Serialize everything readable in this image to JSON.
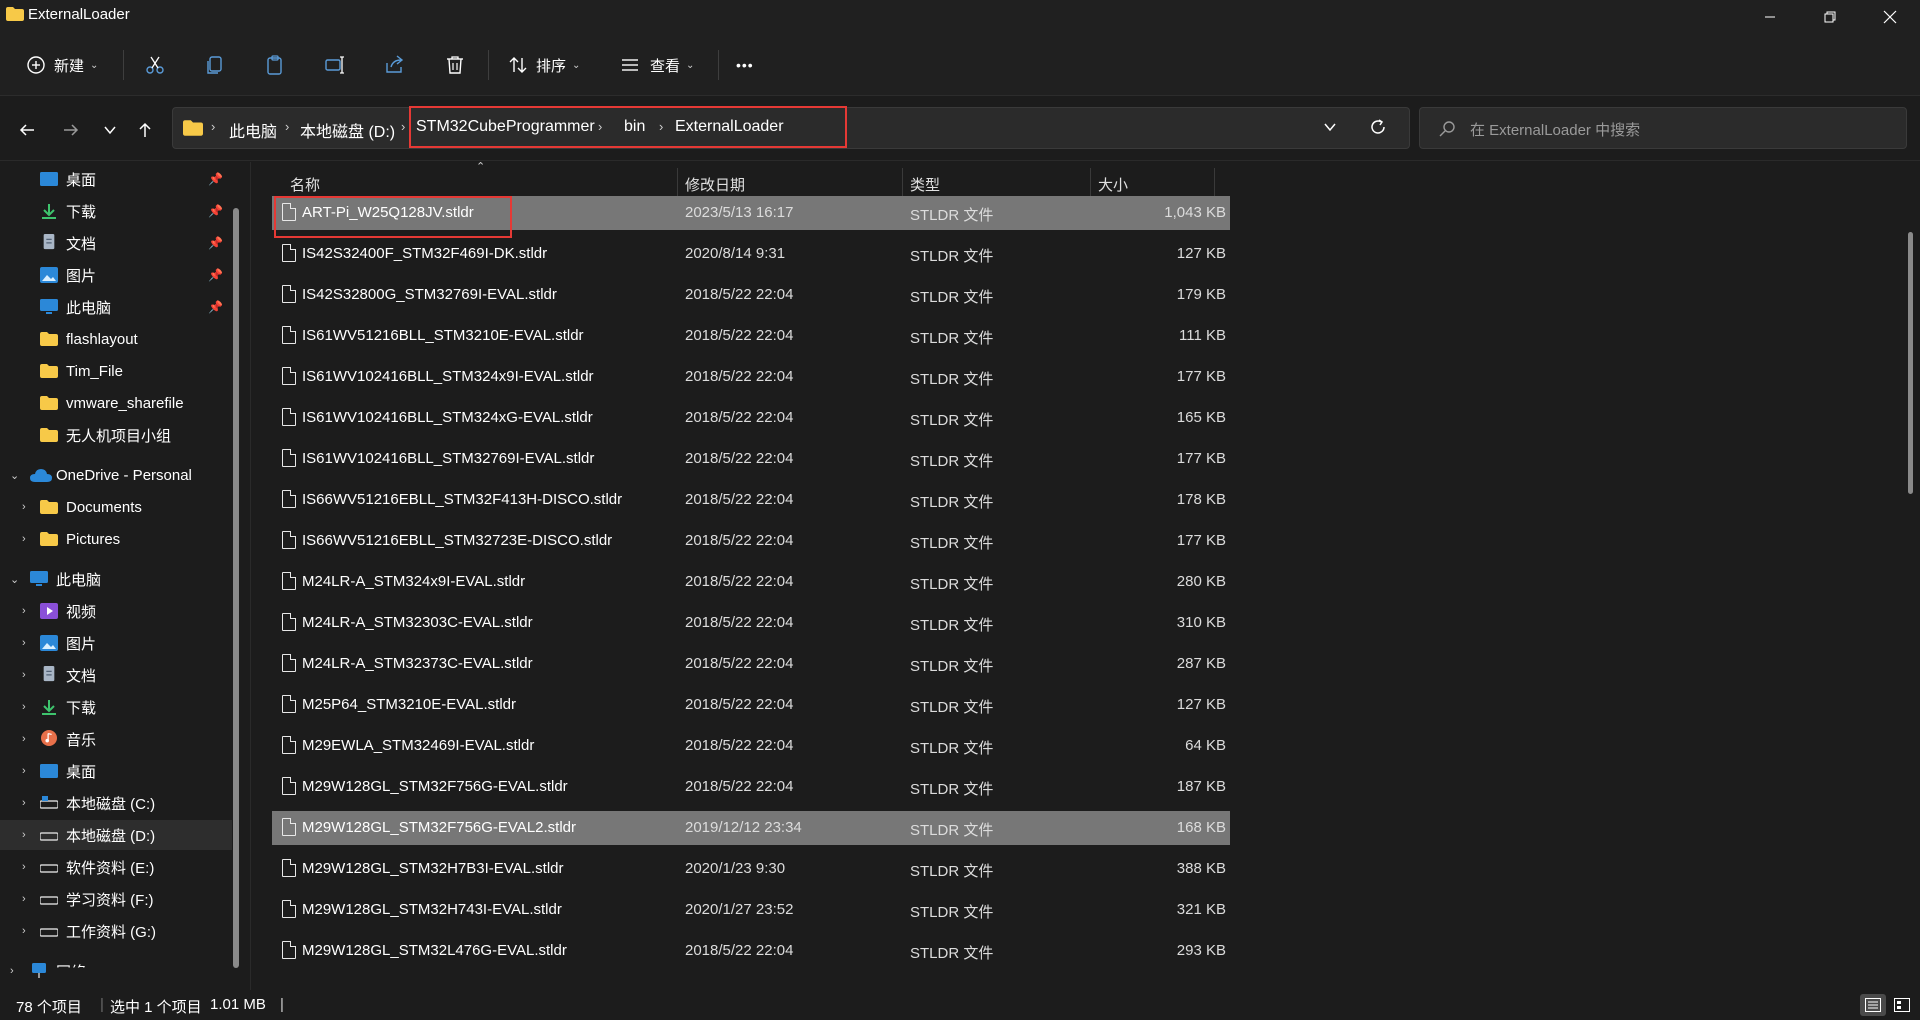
{
  "window": {
    "title": "ExternalLoader"
  },
  "toolbar": {
    "new_label": "新建",
    "sort_label": "排序",
    "view_label": "查看",
    "more_label": "•••"
  },
  "address": {
    "crumbs": [
      "此电脑",
      "本地磁盘 (D:)",
      "STM32CubeProgrammer",
      "bin",
      "ExternalLoader"
    ],
    "search_placeholder": "在 ExternalLoader 中搜索"
  },
  "sidebar": {
    "quick": [
      {
        "label": "桌面",
        "icon": "desktop-icon",
        "pinned": true
      },
      {
        "label": "下载",
        "icon": "download-icon",
        "pinned": true
      },
      {
        "label": "文档",
        "icon": "document-icon",
        "pinned": true
      },
      {
        "label": "图片",
        "icon": "pictures-icon",
        "pinned": true
      },
      {
        "label": "此电脑",
        "icon": "computer-icon",
        "pinned": true
      },
      {
        "label": "flashlayout",
        "icon": "folder-icon",
        "pinned": false
      },
      {
        "label": "Tim_File",
        "icon": "folder-icon",
        "pinned": false
      },
      {
        "label": "vmware_sharefile",
        "icon": "folder-icon",
        "pinned": false
      },
      {
        "label": "无人机项目小组",
        "icon": "folder-icon",
        "pinned": false
      }
    ],
    "onedrive": {
      "label": "OneDrive - Personal"
    },
    "onedrive_children": [
      {
        "label": "Documents"
      },
      {
        "label": "Pictures"
      }
    ],
    "thispc": {
      "label": "此电脑"
    },
    "thispc_children": [
      {
        "label": "视频",
        "icon": "video-icon"
      },
      {
        "label": "图片",
        "icon": "pictures-icon"
      },
      {
        "label": "文档",
        "icon": "document-icon"
      },
      {
        "label": "下载",
        "icon": "download-icon"
      },
      {
        "label": "音乐",
        "icon": "music-icon"
      },
      {
        "label": "桌面",
        "icon": "desktop-icon"
      },
      {
        "label": "本地磁盘 (C:)",
        "icon": "drive-icon"
      },
      {
        "label": "本地磁盘 (D:)",
        "icon": "drive-icon"
      },
      {
        "label": "软件资料 (E:)",
        "icon": "drive-icon"
      },
      {
        "label": "学习资料 (F:)",
        "icon": "drive-icon"
      },
      {
        "label": "工作资料 (G:)",
        "icon": "drive-icon"
      }
    ],
    "network": {
      "label": "网络"
    }
  },
  "columns": {
    "name": "名称",
    "date": "修改日期",
    "type": "类型",
    "size": "大小"
  },
  "files": [
    {
      "name": "ART-Pi_W25Q128JV.stldr",
      "date": "2023/5/13 16:17",
      "type": "STLDR 文件",
      "size": "1,043 KB"
    },
    {
      "name": "IS42S32400F_STM32F469I-DK.stldr",
      "date": "2020/8/14 9:31",
      "type": "STLDR 文件",
      "size": "127 KB"
    },
    {
      "name": "IS42S32800G_STM32769I-EVAL.stldr",
      "date": "2018/5/22 22:04",
      "type": "STLDR 文件",
      "size": "179 KB"
    },
    {
      "name": "IS61WV51216BLL_STM3210E-EVAL.stldr",
      "date": "2018/5/22 22:04",
      "type": "STLDR 文件",
      "size": "111 KB"
    },
    {
      "name": "IS61WV102416BLL_STM324x9I-EVAL.stldr",
      "date": "2018/5/22 22:04",
      "type": "STLDR 文件",
      "size": "177 KB"
    },
    {
      "name": "IS61WV102416BLL_STM324xG-EVAL.stldr",
      "date": "2018/5/22 22:04",
      "type": "STLDR 文件",
      "size": "165 KB"
    },
    {
      "name": "IS61WV102416BLL_STM32769I-EVAL.stldr",
      "date": "2018/5/22 22:04",
      "type": "STLDR 文件",
      "size": "177 KB"
    },
    {
      "name": "IS66WV51216EBLL_STM32F413H-DISCO.stldr",
      "date": "2018/5/22 22:04",
      "type": "STLDR 文件",
      "size": "178 KB"
    },
    {
      "name": "IS66WV51216EBLL_STM32723E-DISCO.stldr",
      "date": "2018/5/22 22:04",
      "type": "STLDR 文件",
      "size": "177 KB"
    },
    {
      "name": "M24LR-A_STM324x9I-EVAL.stldr",
      "date": "2018/5/22 22:04",
      "type": "STLDR 文件",
      "size": "280 KB"
    },
    {
      "name": "M24LR-A_STM32303C-EVAL.stldr",
      "date": "2018/5/22 22:04",
      "type": "STLDR 文件",
      "size": "310 KB"
    },
    {
      "name": "M24LR-A_STM32373C-EVAL.stldr",
      "date": "2018/5/22 22:04",
      "type": "STLDR 文件",
      "size": "287 KB"
    },
    {
      "name": "M25P64_STM3210E-EVAL.stldr",
      "date": "2018/5/22 22:04",
      "type": "STLDR 文件",
      "size": "127 KB"
    },
    {
      "name": "M29EWLA_STM32469I-EVAL.stldr",
      "date": "2018/5/22 22:04",
      "type": "STLDR 文件",
      "size": "64 KB"
    },
    {
      "name": "M29W128GL_STM32F756G-EVAL.stldr",
      "date": "2018/5/22 22:04",
      "type": "STLDR 文件",
      "size": "187 KB"
    },
    {
      "name": "M29W128GL_STM32F756G-EVAL2.stldr",
      "date": "2019/12/12 23:34",
      "type": "STLDR 文件",
      "size": "168 KB"
    },
    {
      "name": "M29W128GL_STM32H7B3I-EVAL.stldr",
      "date": "2020/1/23 9:30",
      "type": "STLDR 文件",
      "size": "388 KB"
    },
    {
      "name": "M29W128GL_STM32H743I-EVAL.stldr",
      "date": "2020/1/27 23:52",
      "type": "STLDR 文件",
      "size": "321 KB"
    },
    {
      "name": "M29W128GL_STM32L476G-EVAL.stldr",
      "date": "2018/5/22 22:04",
      "type": "STLDR 文件",
      "size": "293 KB"
    }
  ],
  "status": {
    "count": "78 个项目",
    "selection": "选中 1 个项目",
    "selection_size": "1.01 MB"
  },
  "colors": {
    "accent_red": "#e53935",
    "folder_yellow": "#f7c948",
    "onedrive_blue": "#2b88d8"
  }
}
